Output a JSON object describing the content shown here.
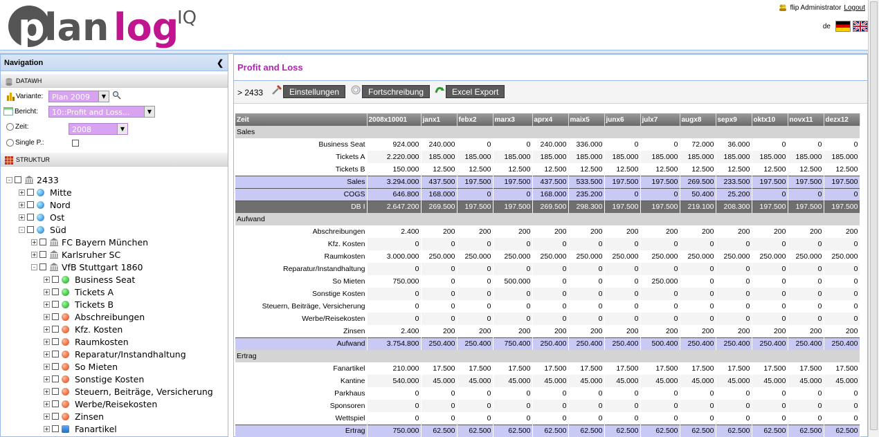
{
  "header": {
    "logo_text": "planlog",
    "logo_suffix": "IQ",
    "user": "flip Administrator",
    "logout": "Logout",
    "lang_label": "de"
  },
  "nav": {
    "title": "Navigation",
    "datawh": "DATAWH",
    "variante_label": "Variante:",
    "variante_value": "Plan 2009",
    "bericht_label": "Bericht:",
    "bericht_value": "10::Profit and Loss...",
    "zeit_label": "Zeit:",
    "zeit_value": "2008",
    "single_label": "Single P.:",
    "struktur": "STRUKTUR",
    "tree": [
      {
        "label": "2433",
        "level": 0,
        "exp": "-",
        "icon": "bank"
      },
      {
        "label": "Mitte",
        "level": 1,
        "exp": "+",
        "icon": "blue"
      },
      {
        "label": "Nord",
        "level": 1,
        "exp": "+",
        "icon": "blue"
      },
      {
        "label": "Ost",
        "level": 1,
        "exp": "+",
        "icon": "blue"
      },
      {
        "label": "Süd",
        "level": 1,
        "exp": "-",
        "icon": "blue"
      },
      {
        "label": "FC Bayern München",
        "level": 2,
        "exp": "+",
        "icon": "bank"
      },
      {
        "label": "Karlsruher SC",
        "level": 2,
        "exp": "+",
        "icon": "bank"
      },
      {
        "label": "VfB Stuttgart 1860",
        "level": 2,
        "exp": "-",
        "icon": "bank"
      },
      {
        "label": "Business Seat",
        "level": 3,
        "exp": "+",
        "icon": "green"
      },
      {
        "label": "Tickets A",
        "level": 3,
        "exp": "+",
        "icon": "green"
      },
      {
        "label": "Tickets B",
        "level": 3,
        "exp": "+",
        "icon": "green"
      },
      {
        "label": "Abschreibungen",
        "level": 3,
        "exp": "+",
        "icon": "red"
      },
      {
        "label": "Kfz. Kosten",
        "level": 3,
        "exp": "+",
        "icon": "red"
      },
      {
        "label": "Raumkosten",
        "level": 3,
        "exp": "+",
        "icon": "red"
      },
      {
        "label": "Reparatur/Instandhaltung",
        "level": 3,
        "exp": "+",
        "icon": "red"
      },
      {
        "label": "So Mieten",
        "level": 3,
        "exp": "+",
        "icon": "red"
      },
      {
        "label": "Sonstige Kosten",
        "level": 3,
        "exp": "+",
        "icon": "red"
      },
      {
        "label": "Steuern, Beiträge, Versicherung",
        "level": 3,
        "exp": "+",
        "icon": "red"
      },
      {
        "label": "Werbe/Reisekosten",
        "level": 3,
        "exp": "+",
        "icon": "red"
      },
      {
        "label": "Zinsen",
        "level": 3,
        "exp": "+",
        "icon": "red"
      },
      {
        "label": "Fanartikel",
        "level": 3,
        "exp": "+",
        "icon": "bluesq"
      }
    ]
  },
  "main": {
    "title": "Profit and Loss",
    "crumb": "> 2433",
    "btn_settings": "Einstellungen",
    "btn_fort": "Fortschreibung",
    "btn_excel": "Excel Export"
  },
  "grid": {
    "columns": [
      "Zeit",
      "2008x10001",
      "janx1",
      "febx2",
      "marx3",
      "aprx4",
      "maix5",
      "junx6",
      "julx7",
      "augx8",
      "sepx9",
      "oktx10",
      "novx11",
      "dezx12"
    ],
    "rows": [
      {
        "type": "sect",
        "label": "Sales"
      },
      {
        "type": "norm",
        "label": "Business Seat",
        "v": [
          "924.000",
          "240.000",
          "0",
          "0",
          "240.000",
          "336.000",
          "0",
          "0",
          "72.000",
          "36.000",
          "0",
          "0",
          "0"
        ]
      },
      {
        "type": "norm",
        "label": "Tickets A",
        "v": [
          "2.220.000",
          "185.000",
          "185.000",
          "185.000",
          "185.000",
          "185.000",
          "185.000",
          "185.000",
          "185.000",
          "185.000",
          "185.000",
          "185.000",
          "185.000"
        ]
      },
      {
        "type": "norm",
        "label": "Tickets B",
        "v": [
          "150.000",
          "12.500",
          "12.500",
          "12.500",
          "12.500",
          "12.500",
          "12.500",
          "12.500",
          "12.500",
          "12.500",
          "12.500",
          "12.500",
          "12.500"
        ]
      },
      {
        "type": "tot",
        "label": "Sales",
        "v": [
          "3.294.000",
          "437.500",
          "197.500",
          "197.500",
          "437.500",
          "533.500",
          "197.500",
          "197.500",
          "269.500",
          "233.500",
          "197.500",
          "197.500",
          "197.500"
        ]
      },
      {
        "type": "tot",
        "label": "COGS",
        "v": [
          "646.800",
          "168.000",
          "0",
          "0",
          "168.000",
          "235.200",
          "0",
          "0",
          "50.400",
          "25.200",
          "0",
          "0",
          "0"
        ]
      },
      {
        "type": "dark",
        "label": "DB I",
        "v": [
          "2.647.200",
          "269.500",
          "197.500",
          "197.500",
          "269.500",
          "298.300",
          "197.500",
          "197.500",
          "219.100",
          "208.300",
          "197.500",
          "197.500",
          "197.500"
        ]
      },
      {
        "type": "sect",
        "label": "Aufwand"
      },
      {
        "type": "norm",
        "label": "Abschreibungen",
        "v": [
          "2.400",
          "200",
          "200",
          "200",
          "200",
          "200",
          "200",
          "200",
          "200",
          "200",
          "200",
          "200",
          "200"
        ]
      },
      {
        "type": "norm",
        "label": "Kfz. Kosten",
        "v": [
          "0",
          "0",
          "0",
          "0",
          "0",
          "0",
          "0",
          "0",
          "0",
          "0",
          "0",
          "0",
          "0"
        ]
      },
      {
        "type": "norm",
        "label": "Raumkosten",
        "v": [
          "3.000.000",
          "250.000",
          "250.000",
          "250.000",
          "250.000",
          "250.000",
          "250.000",
          "250.000",
          "250.000",
          "250.000",
          "250.000",
          "250.000",
          "250.000"
        ]
      },
      {
        "type": "norm",
        "label": "Reparatur/Instandhaltung",
        "v": [
          "0",
          "0",
          "0",
          "0",
          "0",
          "0",
          "0",
          "0",
          "0",
          "0",
          "0",
          "0",
          "0"
        ]
      },
      {
        "type": "norm",
        "label": "So Mieten",
        "v": [
          "750.000",
          "0",
          "0",
          "500.000",
          "0",
          "0",
          "0",
          "250.000",
          "0",
          "0",
          "0",
          "0",
          "0"
        ]
      },
      {
        "type": "norm",
        "label": "Sonstige Kosten",
        "v": [
          "0",
          "0",
          "0",
          "0",
          "0",
          "0",
          "0",
          "0",
          "0",
          "0",
          "0",
          "0",
          "0"
        ]
      },
      {
        "type": "norm",
        "label": "Steuern, Beiträge, Versicherung",
        "v": [
          "0",
          "0",
          "0",
          "0",
          "0",
          "0",
          "0",
          "0",
          "0",
          "0",
          "0",
          "0",
          "0"
        ]
      },
      {
        "type": "norm",
        "label": "Werbe/Reisekosten",
        "v": [
          "0",
          "0",
          "0",
          "0",
          "0",
          "0",
          "0",
          "0",
          "0",
          "0",
          "0",
          "0",
          "0"
        ]
      },
      {
        "type": "norm",
        "label": "Zinsen",
        "v": [
          "2.400",
          "200",
          "200",
          "200",
          "200",
          "200",
          "200",
          "200",
          "200",
          "200",
          "200",
          "200",
          "200"
        ]
      },
      {
        "type": "tot",
        "label": "Aufwand",
        "v": [
          "3.754.800",
          "250.400",
          "250.400",
          "750.400",
          "250.400",
          "250.400",
          "250.400",
          "500.400",
          "250.400",
          "250.400",
          "250.400",
          "250.400",
          "250.400"
        ]
      },
      {
        "type": "sect",
        "label": "Ertrag"
      },
      {
        "type": "norm",
        "label": "Fanartikel",
        "v": [
          "210.000",
          "17.500",
          "17.500",
          "17.500",
          "17.500",
          "17.500",
          "17.500",
          "17.500",
          "17.500",
          "17.500",
          "17.500",
          "17.500",
          "17.500"
        ]
      },
      {
        "type": "norm",
        "label": "Kantine",
        "v": [
          "540.000",
          "45.000",
          "45.000",
          "45.000",
          "45.000",
          "45.000",
          "45.000",
          "45.000",
          "45.000",
          "45.000",
          "45.000",
          "45.000",
          "45.000"
        ]
      },
      {
        "type": "norm",
        "label": "Parkhaus",
        "v": [
          "0",
          "0",
          "0",
          "0",
          "0",
          "0",
          "0",
          "0",
          "0",
          "0",
          "0",
          "0",
          "0"
        ]
      },
      {
        "type": "norm",
        "label": "Sponsoren",
        "v": [
          "0",
          "0",
          "0",
          "0",
          "0",
          "0",
          "0",
          "0",
          "0",
          "0",
          "0",
          "0",
          "0"
        ]
      },
      {
        "type": "norm",
        "label": "Wettspiel",
        "v": [
          "0",
          "0",
          "0",
          "0",
          "0",
          "0",
          "0",
          "0",
          "0",
          "0",
          "0",
          "0",
          "0"
        ]
      },
      {
        "type": "tot",
        "label": "Ertrag",
        "v": [
          "750.000",
          "62.500",
          "62.500",
          "62.500",
          "62.500",
          "62.500",
          "62.500",
          "62.500",
          "62.500",
          "62.500",
          "62.500",
          "62.500",
          "62.500"
        ]
      }
    ]
  }
}
